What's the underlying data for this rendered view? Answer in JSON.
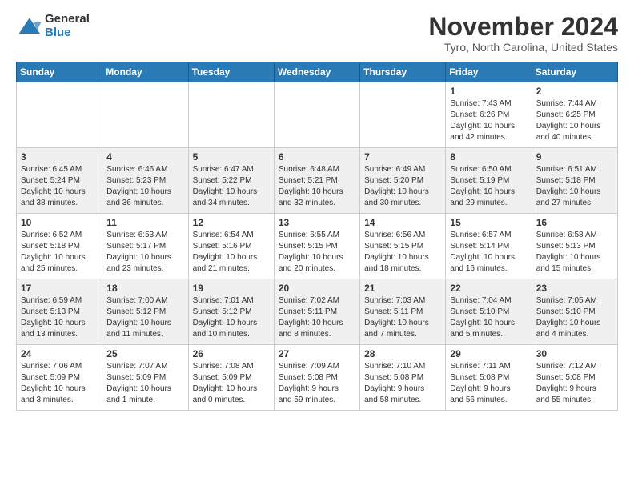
{
  "logo": {
    "general": "General",
    "blue": "Blue"
  },
  "header": {
    "month": "November 2024",
    "location": "Tyro, North Carolina, United States"
  },
  "weekdays": [
    "Sunday",
    "Monday",
    "Tuesday",
    "Wednesday",
    "Thursday",
    "Friday",
    "Saturday"
  ],
  "weeks": [
    [
      {
        "day": "",
        "info": ""
      },
      {
        "day": "",
        "info": ""
      },
      {
        "day": "",
        "info": ""
      },
      {
        "day": "",
        "info": ""
      },
      {
        "day": "",
        "info": ""
      },
      {
        "day": "1",
        "info": "Sunrise: 7:43 AM\nSunset: 6:26 PM\nDaylight: 10 hours\nand 42 minutes."
      },
      {
        "day": "2",
        "info": "Sunrise: 7:44 AM\nSunset: 6:25 PM\nDaylight: 10 hours\nand 40 minutes."
      }
    ],
    [
      {
        "day": "3",
        "info": "Sunrise: 6:45 AM\nSunset: 5:24 PM\nDaylight: 10 hours\nand 38 minutes."
      },
      {
        "day": "4",
        "info": "Sunrise: 6:46 AM\nSunset: 5:23 PM\nDaylight: 10 hours\nand 36 minutes."
      },
      {
        "day": "5",
        "info": "Sunrise: 6:47 AM\nSunset: 5:22 PM\nDaylight: 10 hours\nand 34 minutes."
      },
      {
        "day": "6",
        "info": "Sunrise: 6:48 AM\nSunset: 5:21 PM\nDaylight: 10 hours\nand 32 minutes."
      },
      {
        "day": "7",
        "info": "Sunrise: 6:49 AM\nSunset: 5:20 PM\nDaylight: 10 hours\nand 30 minutes."
      },
      {
        "day": "8",
        "info": "Sunrise: 6:50 AM\nSunset: 5:19 PM\nDaylight: 10 hours\nand 29 minutes."
      },
      {
        "day": "9",
        "info": "Sunrise: 6:51 AM\nSunset: 5:18 PM\nDaylight: 10 hours\nand 27 minutes."
      }
    ],
    [
      {
        "day": "10",
        "info": "Sunrise: 6:52 AM\nSunset: 5:18 PM\nDaylight: 10 hours\nand 25 minutes."
      },
      {
        "day": "11",
        "info": "Sunrise: 6:53 AM\nSunset: 5:17 PM\nDaylight: 10 hours\nand 23 minutes."
      },
      {
        "day": "12",
        "info": "Sunrise: 6:54 AM\nSunset: 5:16 PM\nDaylight: 10 hours\nand 21 minutes."
      },
      {
        "day": "13",
        "info": "Sunrise: 6:55 AM\nSunset: 5:15 PM\nDaylight: 10 hours\nand 20 minutes."
      },
      {
        "day": "14",
        "info": "Sunrise: 6:56 AM\nSunset: 5:15 PM\nDaylight: 10 hours\nand 18 minutes."
      },
      {
        "day": "15",
        "info": "Sunrise: 6:57 AM\nSunset: 5:14 PM\nDaylight: 10 hours\nand 16 minutes."
      },
      {
        "day": "16",
        "info": "Sunrise: 6:58 AM\nSunset: 5:13 PM\nDaylight: 10 hours\nand 15 minutes."
      }
    ],
    [
      {
        "day": "17",
        "info": "Sunrise: 6:59 AM\nSunset: 5:13 PM\nDaylight: 10 hours\nand 13 minutes."
      },
      {
        "day": "18",
        "info": "Sunrise: 7:00 AM\nSunset: 5:12 PM\nDaylight: 10 hours\nand 11 minutes."
      },
      {
        "day": "19",
        "info": "Sunrise: 7:01 AM\nSunset: 5:12 PM\nDaylight: 10 hours\nand 10 minutes."
      },
      {
        "day": "20",
        "info": "Sunrise: 7:02 AM\nSunset: 5:11 PM\nDaylight: 10 hours\nand 8 minutes."
      },
      {
        "day": "21",
        "info": "Sunrise: 7:03 AM\nSunset: 5:11 PM\nDaylight: 10 hours\nand 7 minutes."
      },
      {
        "day": "22",
        "info": "Sunrise: 7:04 AM\nSunset: 5:10 PM\nDaylight: 10 hours\nand 5 minutes."
      },
      {
        "day": "23",
        "info": "Sunrise: 7:05 AM\nSunset: 5:10 PM\nDaylight: 10 hours\nand 4 minutes."
      }
    ],
    [
      {
        "day": "24",
        "info": "Sunrise: 7:06 AM\nSunset: 5:09 PM\nDaylight: 10 hours\nand 3 minutes."
      },
      {
        "day": "25",
        "info": "Sunrise: 7:07 AM\nSunset: 5:09 PM\nDaylight: 10 hours\nand 1 minute."
      },
      {
        "day": "26",
        "info": "Sunrise: 7:08 AM\nSunset: 5:09 PM\nDaylight: 10 hours\nand 0 minutes."
      },
      {
        "day": "27",
        "info": "Sunrise: 7:09 AM\nSunset: 5:08 PM\nDaylight: 9 hours\nand 59 minutes."
      },
      {
        "day": "28",
        "info": "Sunrise: 7:10 AM\nSunset: 5:08 PM\nDaylight: 9 hours\nand 58 minutes."
      },
      {
        "day": "29",
        "info": "Sunrise: 7:11 AM\nSunset: 5:08 PM\nDaylight: 9 hours\nand 56 minutes."
      },
      {
        "day": "30",
        "info": "Sunrise: 7:12 AM\nSunset: 5:08 PM\nDaylight: 9 hours\nand 55 minutes."
      }
    ]
  ]
}
